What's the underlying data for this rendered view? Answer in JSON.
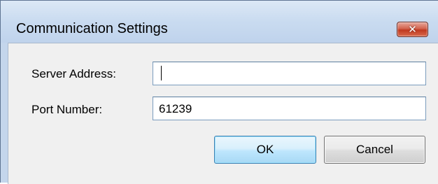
{
  "window": {
    "title": "Communication Settings",
    "close_icon": "close-icon",
    "close_glyph": "✕"
  },
  "form": {
    "server_address_label": "Server Address:",
    "server_address_value": "",
    "port_number_label": "Port Number:",
    "port_number_value": "61239"
  },
  "buttons": {
    "ok_label": "OK",
    "cancel_label": "Cancel"
  },
  "colors": {
    "title_bar": "#c9dbf0",
    "close_button": "#c0391f",
    "dialog_body": "#f0f0f0",
    "default_button": "#bee6fd"
  }
}
